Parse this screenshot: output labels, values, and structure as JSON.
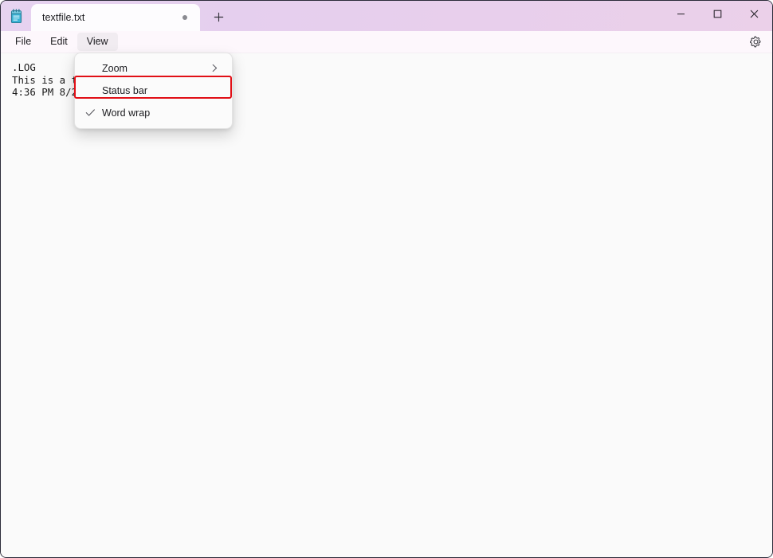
{
  "window": {
    "app_icon": "notepad-icon",
    "background_color": "#fafafa",
    "border_color": "#2c2c3a"
  },
  "titlebar": {
    "gradient_start": "#e6d3f0",
    "gradient_end": "#ebd0e9",
    "tabs": [
      {
        "title": "textfile.txt",
        "modified_indicator": "●",
        "active": true
      }
    ],
    "new_tab": {
      "icon": "plus-icon",
      "label": "+"
    },
    "window_controls": {
      "minimize": "–",
      "maximize": "□",
      "close": "✕"
    }
  },
  "menubar": {
    "background_color": "#fdf7fc",
    "items": [
      {
        "label": "File",
        "active": false
      },
      {
        "label": "Edit",
        "active": false
      },
      {
        "label": "View",
        "active": true
      }
    ],
    "settings": {
      "icon": "gear-icon",
      "label": "Settings"
    }
  },
  "view_menu": {
    "items": [
      {
        "label": "Zoom",
        "checked": false,
        "has_submenu": true,
        "submenu_icon": "chevron-right-icon",
        "highlighted": false
      },
      {
        "label": "Status bar",
        "checked": false,
        "has_submenu": false,
        "highlighted": true
      },
      {
        "label": "Word wrap",
        "checked": true,
        "check_icon": "check-icon",
        "has_submenu": false,
        "highlighted": false
      }
    ]
  },
  "annotation": {
    "color": "#e10f16",
    "target": "Status bar"
  },
  "editor": {
    "content": ".LOG\nThis is a t\n4:36 PM 8/2",
    "background_color": "#fafafa",
    "text_color": "#1a1a1a"
  }
}
